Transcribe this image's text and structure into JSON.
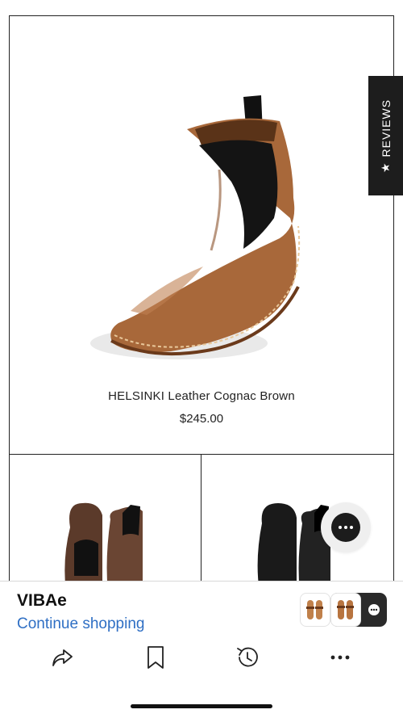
{
  "product_main": {
    "name": "HELSINKI Leather Cognac Brown",
    "price": "$245.00",
    "image_icon": "cognac-chelsea-boot-image"
  },
  "product_grid": {
    "left_image_icon": "brown-boots-pair-image",
    "right_image_icon": "black-boots-pair-image"
  },
  "reviews_tab": {
    "label": "REVIEWS",
    "star": "★"
  },
  "chat": {
    "icon": "chat-bubble-icon"
  },
  "bottom_sheet": {
    "store_name": "VIBAe",
    "continue_label": "Continue shopping",
    "toolbar": [
      "share-icon",
      "bookmark-icon",
      "history-icon",
      "more-icon"
    ]
  },
  "colors": {
    "accent_link": "#2f6fc4",
    "boot_cognac": "#a8683a",
    "dark": "#1d1d1d"
  }
}
